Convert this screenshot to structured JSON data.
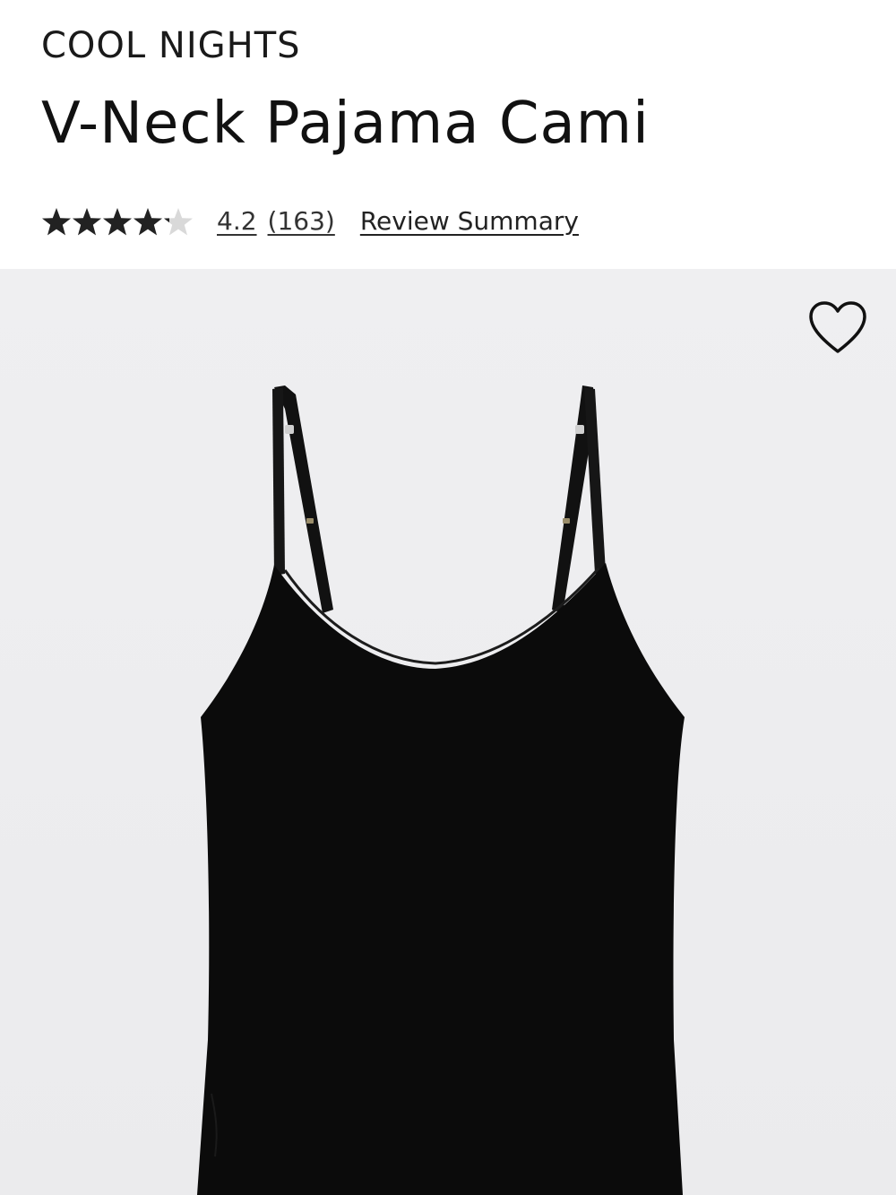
{
  "product": {
    "brand": "COOL NIGHTS",
    "title": "V-Neck Pajama Cami",
    "rating": {
      "value": "4.2",
      "value_numeric": 4.2,
      "max": 5,
      "count": "(163)",
      "review_summary_label": "Review Summary"
    }
  },
  "icons": {
    "rating_star": "star-icon",
    "favorite": "heart-outline-icon"
  },
  "colors": {
    "star_filled": "#222222",
    "star_empty": "#d9d9d9",
    "image_background": "#eeeef0",
    "garment": "#0b0b0b"
  }
}
